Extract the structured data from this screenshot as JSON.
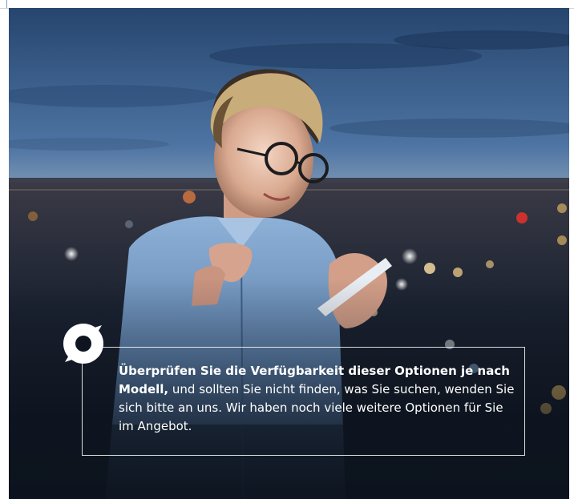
{
  "info": {
    "lead": "Überprüfen Sie die Verfügbarkeit dieser Optionen je nach Modell,",
    "body": " und sollten Sie nicht finden, was Sie suchen, wenden Sie sich bitte an uns. Wir haben noch viele weitere Optionen für Sie im Angebot."
  },
  "icons": {
    "badge": "ring-logo-icon"
  },
  "colors": {
    "box_border": "#ffffff",
    "text": "#ffffff",
    "sky_top": "#2f4f78",
    "sky_horizon": "#e8d4b6",
    "shirt": "#6f93bd"
  }
}
